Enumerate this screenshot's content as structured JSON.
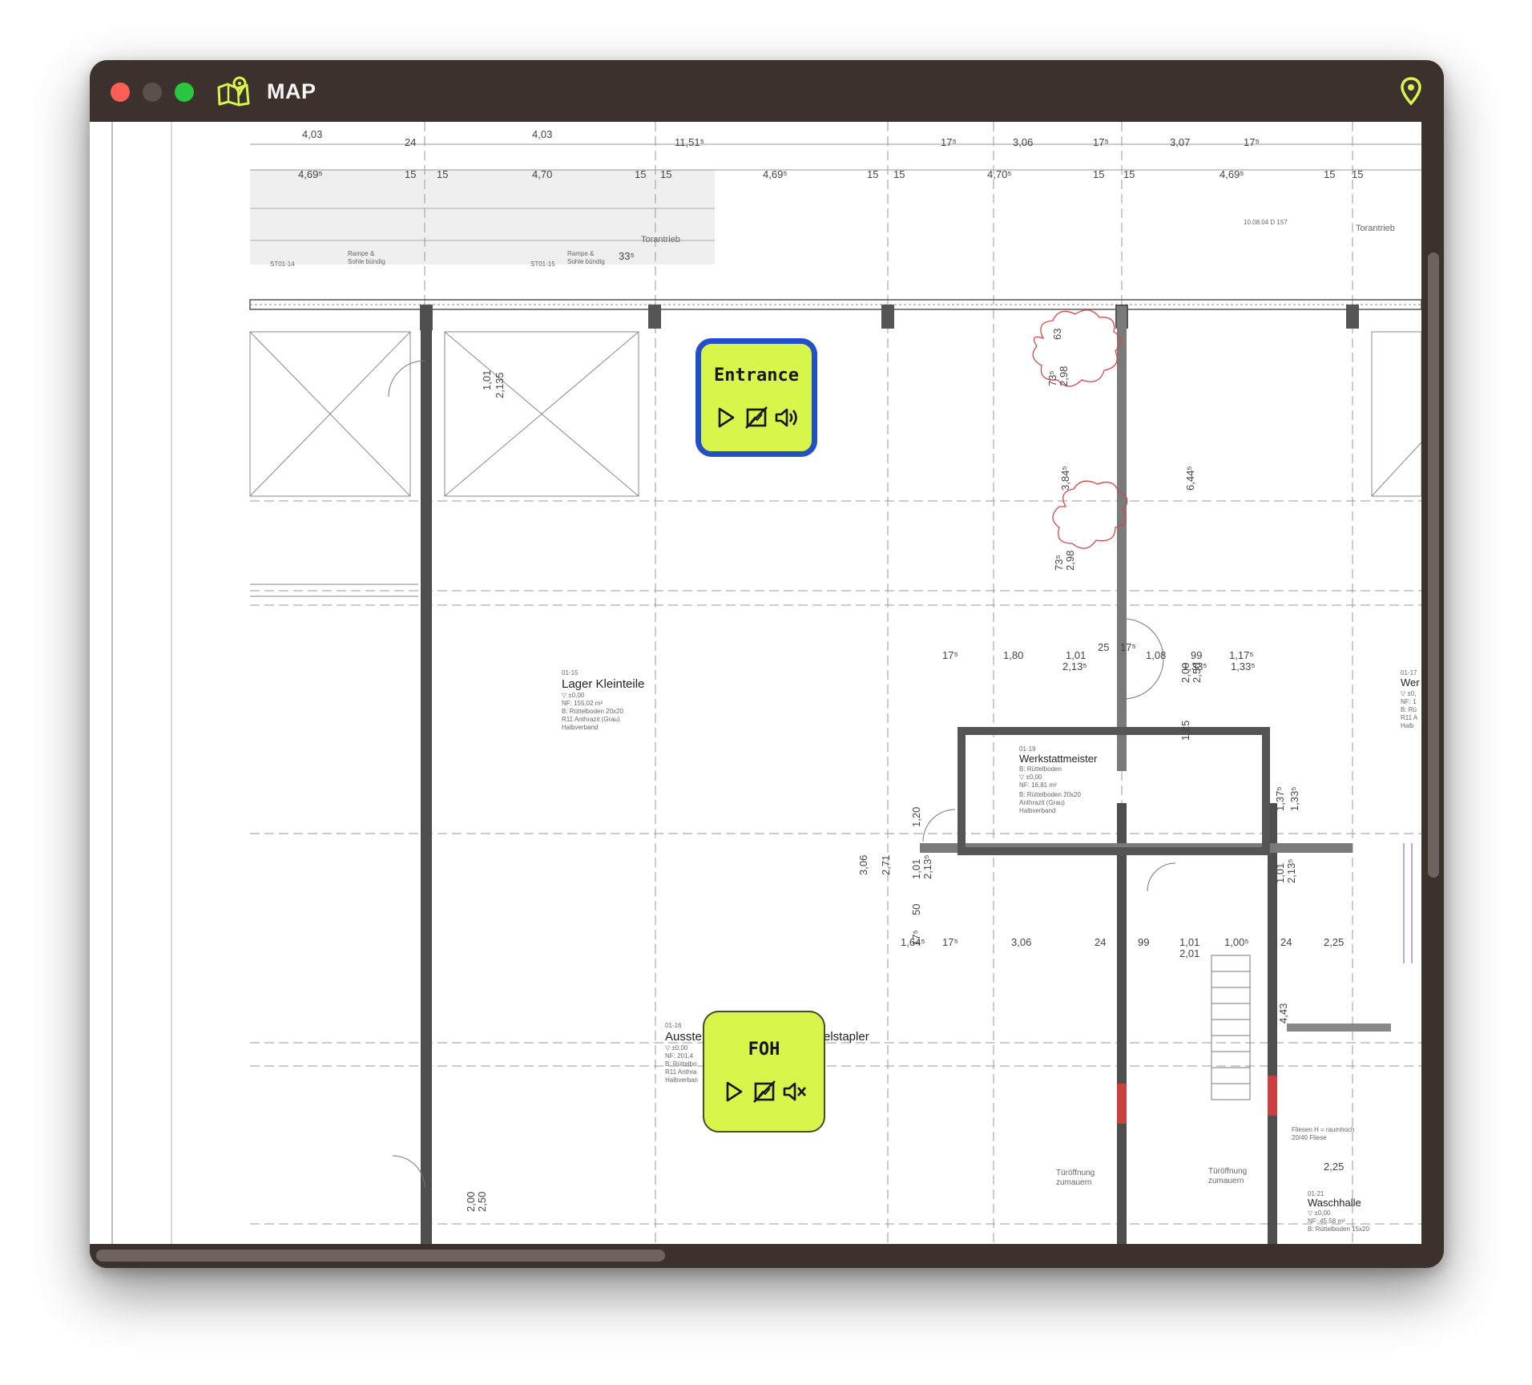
{
  "window": {
    "title": "MAP",
    "colors": {
      "chrome": "#3d312d",
      "accent": "#d7f54a",
      "selected_border": "#2250c8"
    }
  },
  "titlebar": {
    "app_icon": "map-icon",
    "location_icon": "location-pin-icon"
  },
  "floorplan": {
    "rooms": [
      {
        "number": "01-15",
        "name": "Lager Kleinteile",
        "details": [
          "▽ ±0,00",
          "NF: 155,02 m²",
          "B: Rüttelboden 20x20",
          "R11 Anthrazit (Grau)",
          "Halbverband"
        ]
      },
      {
        "number": "01-19",
        "name": "Werkstattmeister",
        "details": [
          "B: Rüttelboden",
          "▽ ±0,00",
          "NF: 16,81 m²",
          "B: Rüttelboden 20x20",
          "Anthrazit (Grau)",
          "Halbverband"
        ]
      },
      {
        "number": "01-16",
        "name": "Ausste",
        "name_suffix": "elstapler",
        "details": [
          "▽ ±0,00",
          "NF: 201,4",
          "B: Rüttelbo",
          "R11 Anthra",
          "Halbverban"
        ]
      },
      {
        "number": "01-21",
        "name": "Waschhalle",
        "details": [
          "▽ ±0,00",
          "NF: 45,58 m²",
          "B: Rüttelboden 15x20"
        ]
      },
      {
        "number": "01-17",
        "name": "Wer",
        "details": [
          "▽ ±0,",
          "NF: 1",
          "B: Rü",
          "R11 A",
          "Halb"
        ]
      }
    ],
    "labels": {
      "torantrieb_1": "Torantrieb",
      "torantrieb_2": "Torantrieb",
      "tueroeffnung_1a": "Türöffnung",
      "tueroeffnung_1b": "zumauern",
      "tueroeffnung_2a": "Türöffnung",
      "tueroeffnung_2b": "zumauern",
      "rampe_1a": "Rampe &",
      "rampe_1b": "Sohle bündig",
      "rampe_2a": "Rampe &",
      "rampe_2b": "Sohle bündig",
      "door_tag_1": "ST01-14",
      "door_tag_2": "ST01-15",
      "ref": "10.08.04 D 157",
      "fliesen": "Fliesen H = raumhoch",
      "fliesen2": "20/40 Fliese"
    },
    "dimensions": {
      "top_row_1": [
        "4,03",
        "24",
        "4,03",
        "11,51⁵",
        "17⁵",
        "3,06",
        "17⁵",
        "3,07",
        "17⁵"
      ],
      "top_row_2": [
        "4,69⁵",
        "15",
        "15",
        "4,70",
        "15",
        "15",
        "4,69⁵",
        "15",
        "15",
        "4,70⁵",
        "15",
        "15",
        "4,69⁵",
        "15",
        "15"
      ],
      "mid_row": [
        "17⁵",
        "1,80",
        "1,01",
        "25",
        "17⁵",
        "1,08",
        "99",
        "1,17⁵",
        "2,13⁵",
        "1,33⁵",
        "1,33⁵"
      ],
      "lower_row": [
        "1,64⁵",
        "17⁵",
        "3,06",
        "24",
        "99",
        "1,01",
        "1,00⁵",
        "24",
        "2,25",
        "2,01"
      ],
      "verticals": [
        "3,84⁵",
        "6,44⁵",
        "2,00",
        "2,50",
        "1,25",
        "3,06",
        "2,71",
        "1,20",
        "1,01",
        "2,13⁵",
        "50",
        "17⁵",
        "1,37⁵",
        "1,33⁵",
        "4,43",
        "2,25",
        "2,00",
        "2,50",
        "1,01",
        "2,135",
        "50",
        "73⁵",
        "2,98",
        "63",
        "33⁵"
      ]
    }
  },
  "zones": [
    {
      "label": "Entrance",
      "selected": true,
      "icons": [
        "play-icon",
        "no-video-icon",
        "volume-on-icon"
      ]
    },
    {
      "label": "FOH",
      "selected": false,
      "icons": [
        "play-icon",
        "no-video-icon",
        "volume-muted-icon"
      ]
    }
  ]
}
